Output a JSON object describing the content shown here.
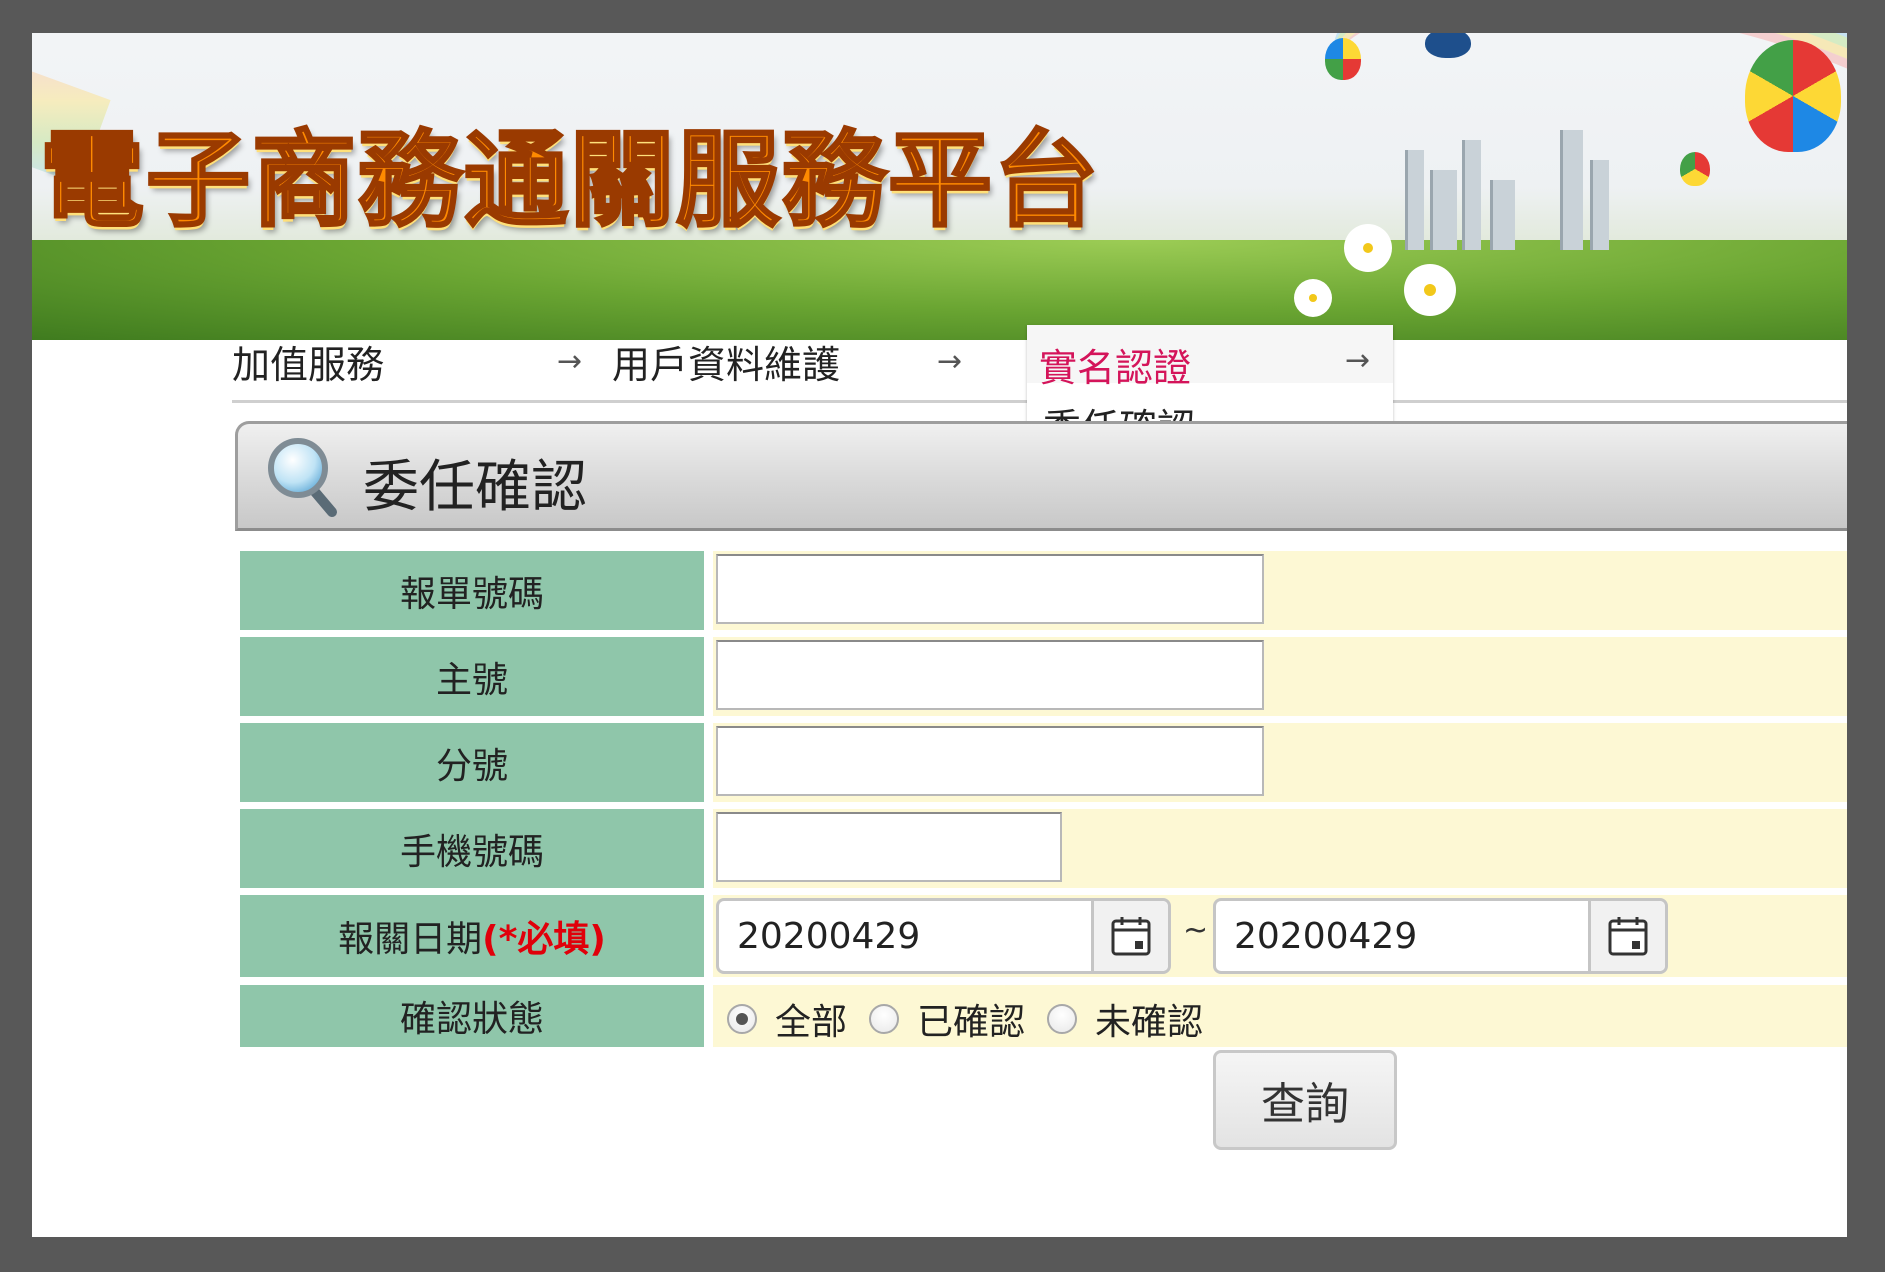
{
  "banner": {
    "title": "電子商務通關服務平台"
  },
  "breadcrumb": {
    "items": [
      {
        "label": "加值服務"
      },
      {
        "label": "用戶資料維護"
      },
      {
        "label": "實名認證"
      }
    ],
    "dropdown_item": "委任確認",
    "arrow_glyph": "→"
  },
  "page": {
    "title": "委任確認",
    "title_icon": "magnifier-icon"
  },
  "form": {
    "declaration_no": {
      "label": "報單號碼",
      "value": ""
    },
    "master_no": {
      "label": "主號",
      "value": ""
    },
    "sub_no": {
      "label": "分號",
      "value": ""
    },
    "mobile_no": {
      "label": "手機號碼",
      "value": ""
    },
    "declaration_date": {
      "label": "報關日期",
      "required_mark": "(*必填)",
      "from": "20200429",
      "separator": "~",
      "to": "20200429",
      "icon": "calendar-icon"
    },
    "confirm_status": {
      "label": "確認狀態",
      "options": [
        {
          "label": "全部",
          "checked": true
        },
        {
          "label": "已確認",
          "checked": false
        },
        {
          "label": "未確認",
          "checked": false
        }
      ]
    },
    "query_button": "查詢"
  },
  "colors": {
    "label_bg": "#8fc6aa",
    "field_bg": "#fdf8d4",
    "active_crumb": "#d4145a",
    "required": "#e0000a"
  }
}
